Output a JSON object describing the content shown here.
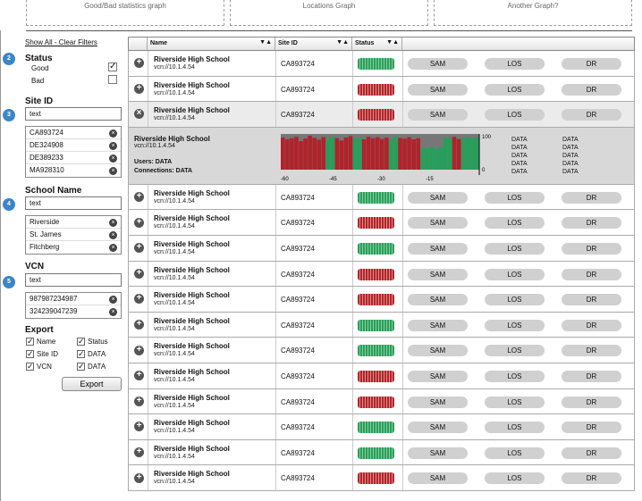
{
  "graphs": [
    "Good/Bad statistics graph",
    "Locations Graph",
    "Another Graph?"
  ],
  "filters": {
    "show_all": "Show All - Clear Filters",
    "status": {
      "badge": "2",
      "title": "Status",
      "options": [
        {
          "label": "Good",
          "checked": true
        },
        {
          "label": "Bad",
          "checked": false
        }
      ]
    },
    "site_id": {
      "badge": "3",
      "title": "Site ID",
      "input": "text",
      "tags": [
        "CA893724",
        "DE324908",
        "DE389233",
        "MA928310"
      ]
    },
    "school_name": {
      "badge": "4",
      "title": "School Name",
      "input": "text",
      "tags": [
        "Riverside",
        "St. James",
        "Fitchberg"
      ]
    },
    "vcn": {
      "badge": "5",
      "title": "VCN",
      "input": "text",
      "tags": [
        "987987234987",
        "324239047239"
      ]
    }
  },
  "export": {
    "title": "Export",
    "options": [
      {
        "label": "Name",
        "checked": true
      },
      {
        "label": "Status",
        "checked": true
      },
      {
        "label": "Site ID",
        "checked": true
      },
      {
        "label": "DATA",
        "checked": true
      },
      {
        "label": "VCN",
        "checked": true
      },
      {
        "label": "DATA",
        "checked": true
      }
    ],
    "button": "Export"
  },
  "table": {
    "headers": {
      "name": "Name",
      "site_id": "Site ID",
      "status": "Status"
    },
    "sort_icon": "▼▲",
    "actions": [
      "SAM",
      "LOS",
      "DR"
    ],
    "rows": [
      {
        "name": "Riverside High School",
        "vcn": "vcn://10.1.4.54",
        "site": "CA893724",
        "status": "good",
        "expanded": false
      },
      {
        "name": "Riverside High School",
        "vcn": "vcn://10.1.4.54",
        "site": "CA893724",
        "status": "bad",
        "expanded": false
      },
      {
        "name": "Riverside High School",
        "vcn": "vcn://10.1.4.54",
        "site": "CA893724",
        "status": "bad",
        "expanded": true
      },
      {
        "name": "Riverside High School",
        "vcn": "vcn://10.1.4.54",
        "site": "CA893724",
        "status": "good",
        "expanded": false
      },
      {
        "name": "Riverside High School",
        "vcn": "vcn://10.1.4.54",
        "site": "CA893724",
        "status": "bad",
        "expanded": false
      },
      {
        "name": "Riverside High School",
        "vcn": "vcn://10.1.4.54",
        "site": "CA893724",
        "status": "good",
        "expanded": false
      },
      {
        "name": "Riverside High School",
        "vcn": "vcn://10.1.4.54",
        "site": "CA893724",
        "status": "bad",
        "expanded": false
      },
      {
        "name": "Riverside High School",
        "vcn": "vcn://10.1.4.54",
        "site": "CA893724",
        "status": "bad",
        "expanded": false
      },
      {
        "name": "Riverside High School",
        "vcn": "vcn://10.1.4.54",
        "site": "CA893724",
        "status": "good",
        "expanded": false
      },
      {
        "name": "Riverside High School",
        "vcn": "vcn://10.1.4.54",
        "site": "CA893724",
        "status": "good",
        "expanded": false
      },
      {
        "name": "Riverside High School",
        "vcn": "vcn://10.1.4.54",
        "site": "CA893724",
        "status": "bad",
        "expanded": false
      },
      {
        "name": "Riverside High School",
        "vcn": "vcn://10.1.4.54",
        "site": "CA893724",
        "status": "bad",
        "expanded": false
      },
      {
        "name": "Riverside High School",
        "vcn": "vcn://10.1.4.54",
        "site": "CA893724",
        "status": "good",
        "expanded": false
      },
      {
        "name": "Riverside High School",
        "vcn": "vcn://10.1.4.54",
        "site": "CA893724",
        "status": "good",
        "expanded": false
      },
      {
        "name": "Riverside High School",
        "vcn": "vcn://10.1.4.54",
        "site": "CA893724",
        "status": "bad",
        "expanded": false
      }
    ],
    "detail": {
      "name": "Riverside High School",
      "vcn": "vcn://10.1.4.54",
      "users": "Users: DATA",
      "connections": "Connections: DATA",
      "data_col1": [
        "DATA",
        "DATA",
        "DATA",
        "DATA",
        "DATA"
      ],
      "data_col2": [
        "DATA",
        "DATA",
        "DATA",
        "DATA",
        "DATA"
      ]
    }
  },
  "chart_data": {
    "type": "bar",
    "x_ticks": [
      "-60",
      "-45",
      "-30",
      "-15"
    ],
    "y_ticks": [
      "100",
      "0"
    ],
    "ylim": [
      0,
      100
    ],
    "series": [
      {
        "values": [
          90,
          85,
          88,
          92,
          80,
          87,
          95,
          89,
          84,
          91,
          86,
          93,
          88,
          82,
          90,
          94,
          87,
          89,
          85,
          92,
          88,
          91,
          86,
          90,
          84,
          93,
          89,
          87,
          91,
          85,
          88,
          62,
          60,
          64,
          58,
          63,
          90,
          88,
          92,
          86,
          89,
          91,
          87,
          90
        ]
      },
      {
        "values": [
          10,
          15,
          12,
          8,
          20,
          13,
          5,
          11,
          16,
          9,
          14,
          7,
          12,
          18,
          10,
          6,
          13,
          11,
          15,
          8,
          12,
          9,
          14,
          10,
          16,
          7,
          11,
          13,
          9,
          15,
          12,
          38,
          40,
          36,
          42,
          37,
          10,
          12,
          8,
          14,
          11,
          9,
          13,
          10
        ]
      }
    ],
    "bar_status": [
      "bad",
      "bad",
      "bad",
      "bad",
      "bad",
      "bad",
      "bad",
      "bad",
      "bad",
      "bad",
      "good",
      "good",
      "bad",
      "bad",
      "bad",
      "bad",
      "good",
      "good",
      "bad",
      "bad",
      "bad",
      "bad",
      "bad",
      "bad",
      "good",
      "good",
      "bad",
      "bad",
      "bad",
      "bad",
      "bad",
      "good",
      "good",
      "good",
      "good",
      "good",
      "good",
      "good",
      "bad",
      "bad",
      "good",
      "good",
      "good",
      "good"
    ],
    "colors": {
      "good": "#25a05a",
      "bad": "#b0232b",
      "bg": "#777777"
    }
  }
}
